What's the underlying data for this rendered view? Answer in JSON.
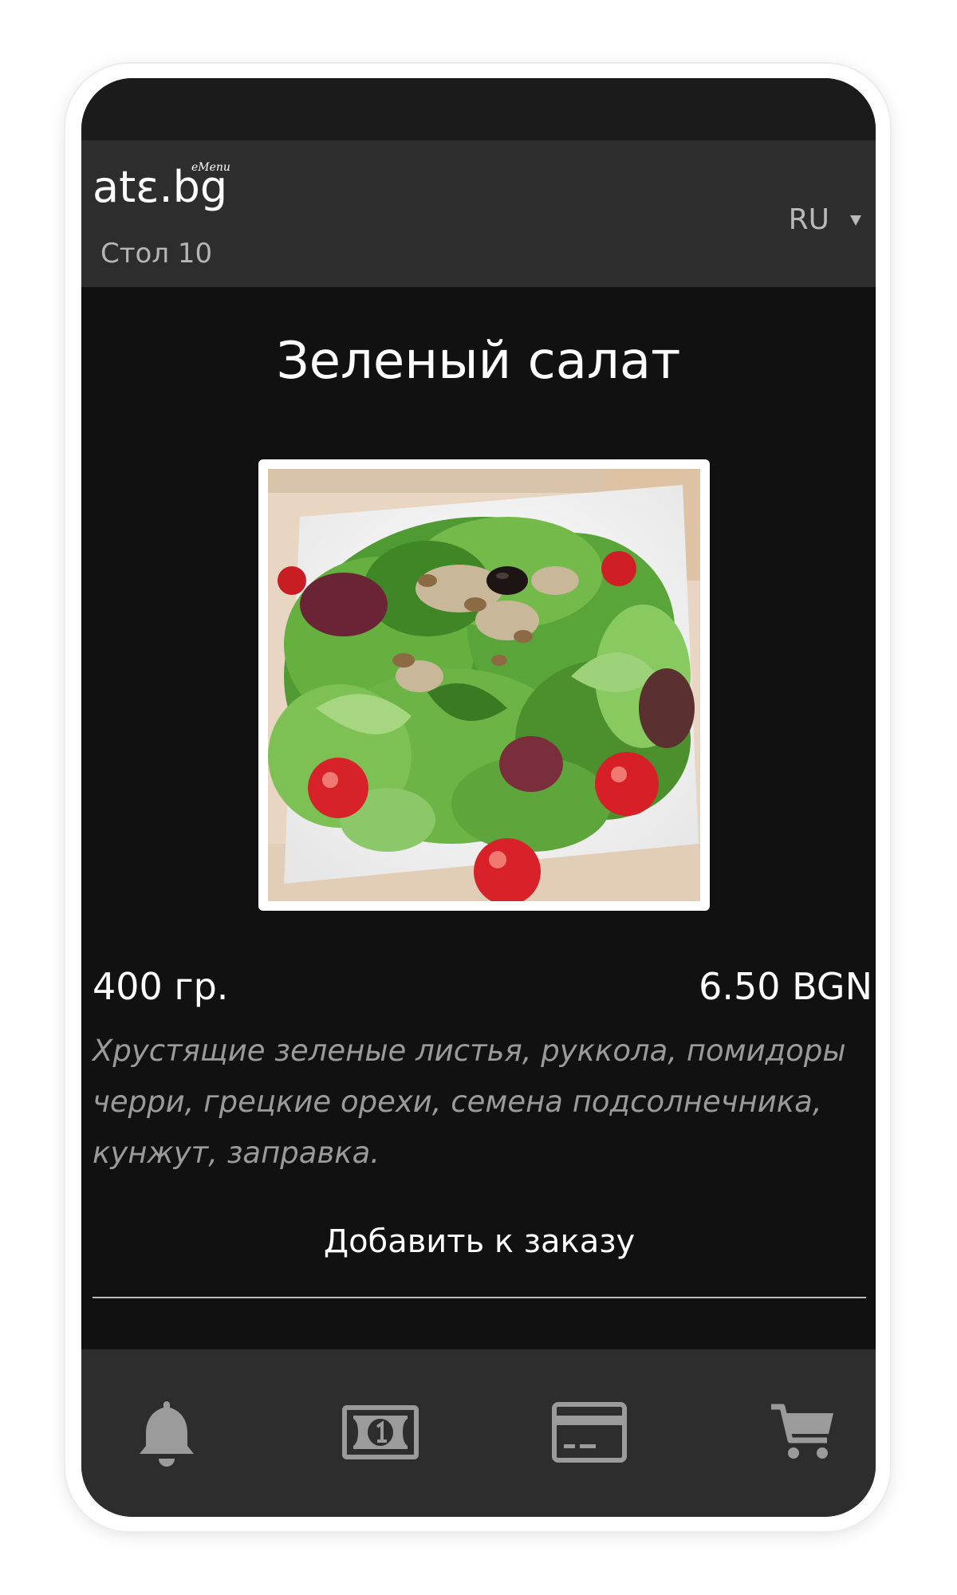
{
  "header": {
    "logo_text": "atɛ.bg",
    "logo_superscript": "eMenu",
    "table_label": "Стол 10",
    "language": "RU"
  },
  "product": {
    "title": "Зеленый салат",
    "weight": "400 гр.",
    "price": "6.50 BGN",
    "description": "Хрустящие зеленые листья, руккола, помидоры черри, грецкие орехи, семена подсолнечника, кунжут, заправка.",
    "add_button_label": "Добавить к заказу"
  },
  "bottom_nav": {
    "icons": [
      "bell-icon",
      "cash-icon",
      "credit-card-icon",
      "cart-icon"
    ]
  },
  "colors": {
    "background": "#111111",
    "header_bg": "#2d2d2d",
    "icon_gray": "#9b9b9b",
    "description_gray": "#9a9a9a"
  }
}
